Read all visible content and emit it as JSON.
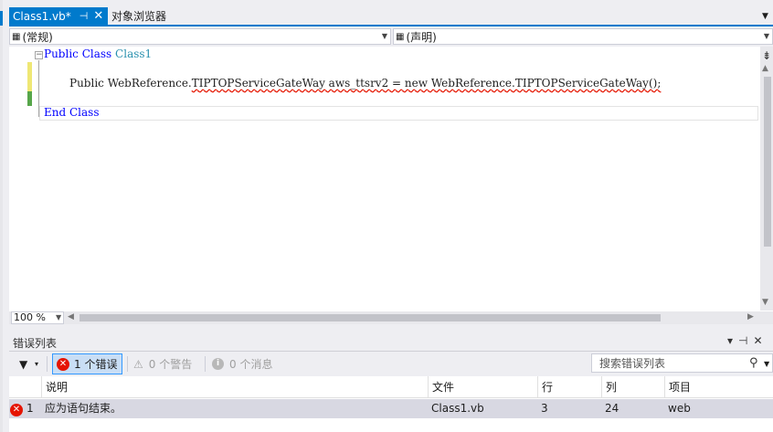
{
  "tabs": [
    {
      "label": "Class1.vb*",
      "pin": "⊣",
      "close": "✕",
      "active": true
    },
    {
      "label": "对象浏览器",
      "active": false
    }
  ],
  "nav_bar": {
    "left_dropdown": "(常规)",
    "right_dropdown": "(声明)"
  },
  "code": {
    "line1": {
      "kw1": "Public",
      "kw2": "Class",
      "name": "Class1"
    },
    "line3": {
      "kw1": "Public",
      "var": "WebReference.",
      "rest": "TIPTOPServiceGateWay aws_ttsrv2 = new WebReference.TIPTOPServiceGateWay();"
    },
    "line5": {
      "text": "End Class"
    }
  },
  "zoom": "100 %",
  "error_list": {
    "title": "错误列表",
    "errors_button": "1 个错误",
    "warnings_button": "0 个警告",
    "messages_button": "0 个消息",
    "search_placeholder": "搜索错误列表",
    "columns": [
      "说明",
      "文件",
      "行",
      "列",
      "项目"
    ],
    "rows": [
      {
        "index": "1",
        "description": "应为语句结束。",
        "file": "Class1.vb",
        "line": "3",
        "column": "24",
        "project": "web"
      }
    ]
  },
  "colors": {
    "accent": "#007acc",
    "error": "#e51400",
    "keyword": "#0000ff",
    "type": "#2b91af"
  }
}
